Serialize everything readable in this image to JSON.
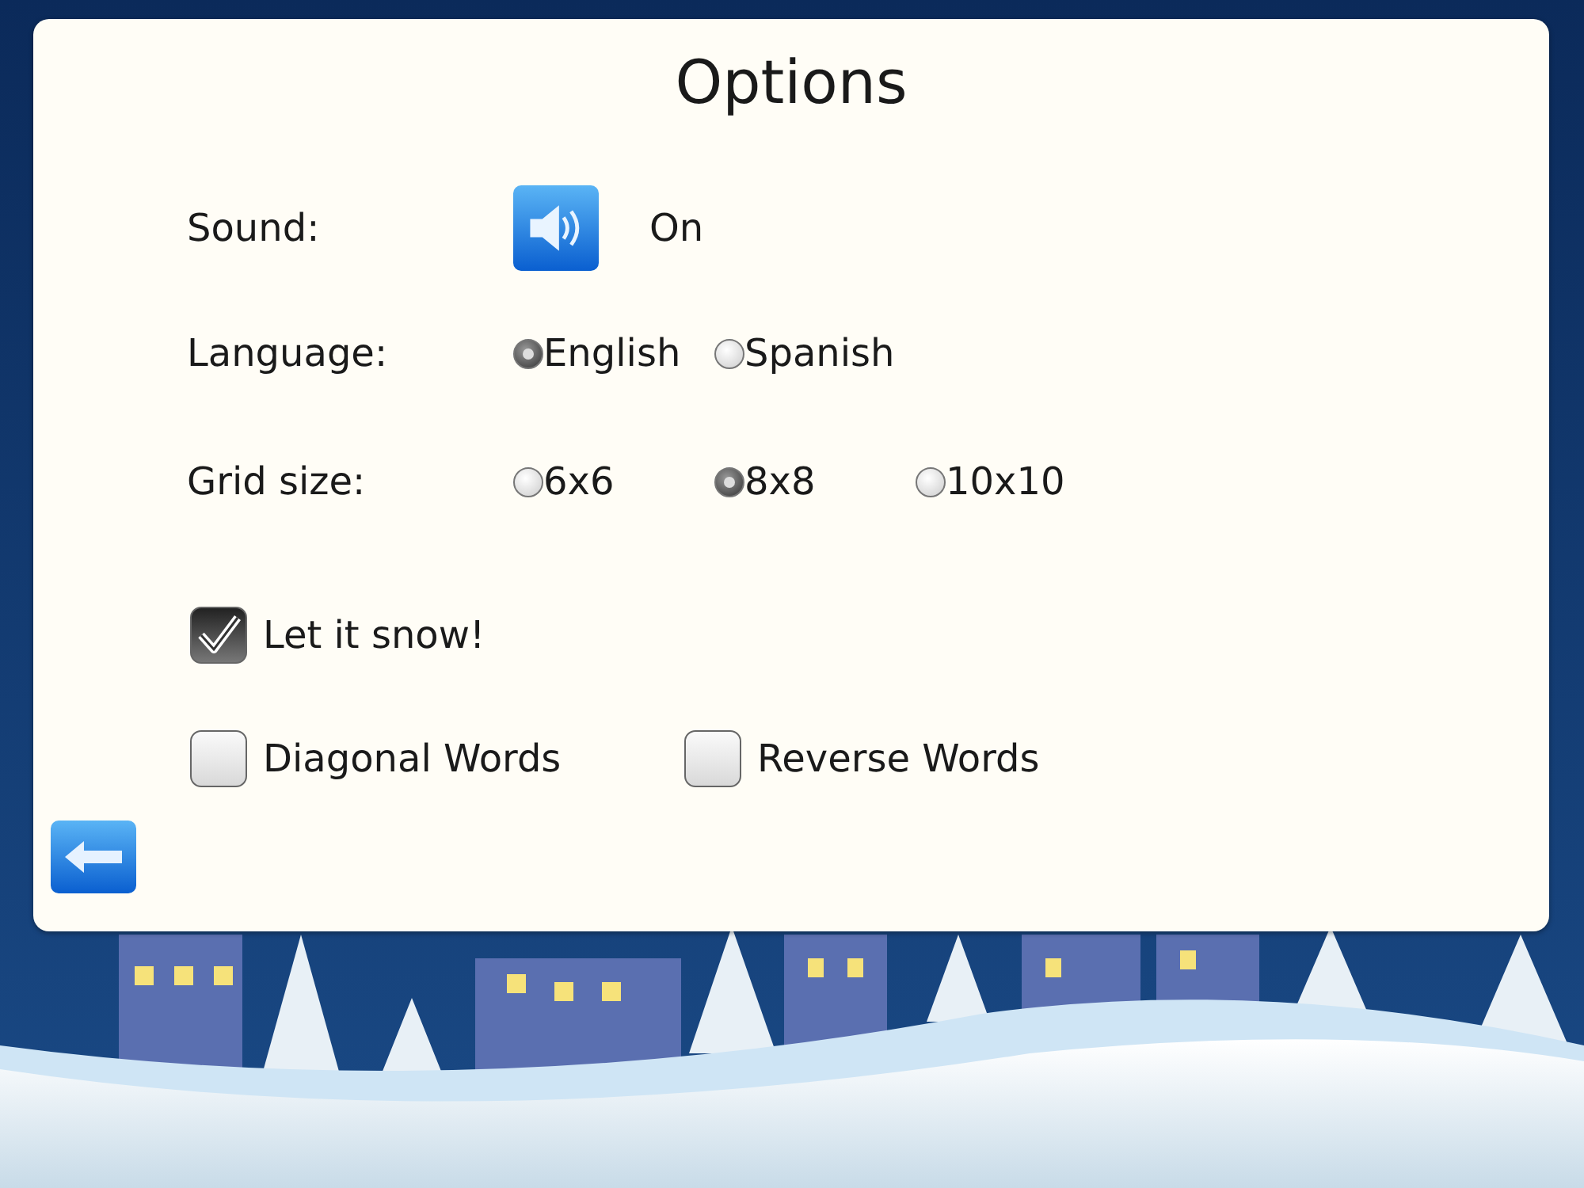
{
  "title": "Options",
  "sound": {
    "label": "Sound:",
    "on": true,
    "value": "On"
  },
  "language": {
    "label": "Language:",
    "options": [
      {
        "label": "English",
        "selected": true
      },
      {
        "label": "Spanish",
        "selected": false
      }
    ]
  },
  "grid_size": {
    "label": "Grid size:",
    "options": [
      {
        "label": "6x6",
        "selected": false
      },
      {
        "label": "8x8",
        "selected": true
      },
      {
        "label": "10x10",
        "selected": false
      }
    ]
  },
  "toggle_rows": [
    [
      {
        "label": "Let it snow!",
        "checked": true
      }
    ],
    [
      {
        "label": "Diagonal Words",
        "checked": false
      },
      {
        "label": "Reverse Words",
        "checked": false
      }
    ]
  ]
}
